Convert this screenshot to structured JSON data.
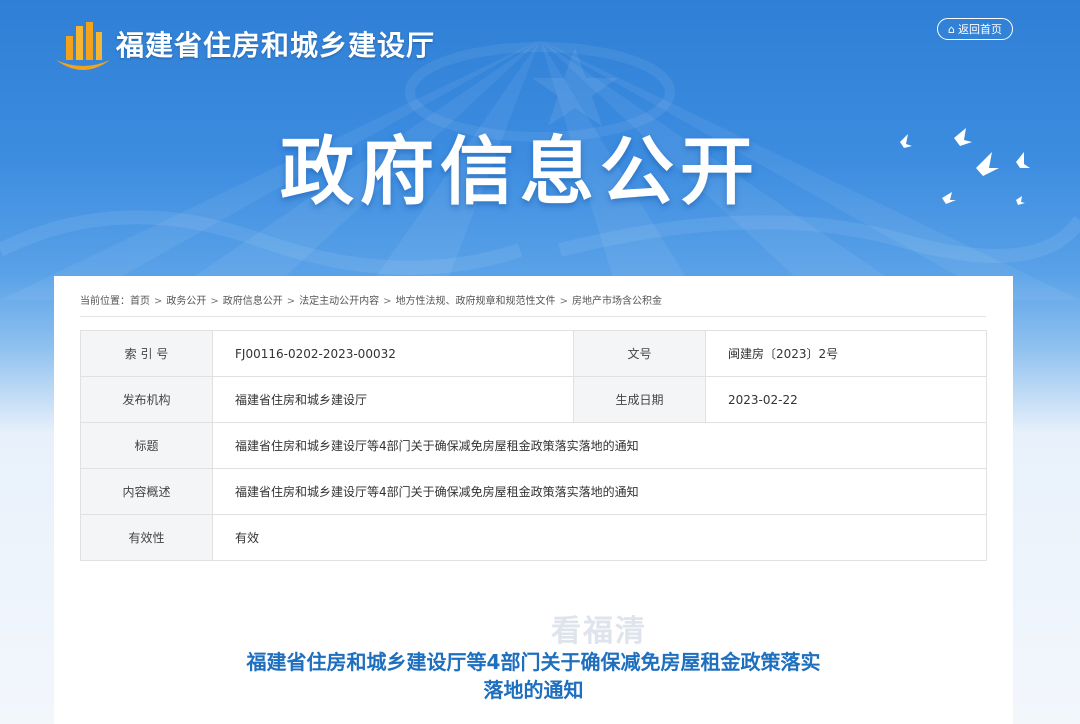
{
  "header": {
    "site_name": "福建省住房和城乡建设厅",
    "back_home_label": "返回首页",
    "hero_title": "政府信息公开"
  },
  "breadcrumb": {
    "prefix": "当前位置：",
    "items": [
      "首页",
      "政务公开",
      "政府信息公开",
      "法定主动公开内容",
      "地方性法规、政府规章和规范性文件",
      "房地产市场含公积金"
    ],
    "separator": ">"
  },
  "meta": {
    "index_no_label": "索 引 号",
    "index_no": "FJ00116-0202-2023-00032",
    "doc_no_label": "文号",
    "doc_no": "闽建房〔2023〕2号",
    "publisher_label": "发布机构",
    "publisher": "福建省住房和城乡建设厅",
    "date_label": "生成日期",
    "date": "2023-02-22",
    "title_label": "标题",
    "title": "福建省住房和城乡建设厅等4部门关于确保减免房屋租金政策落实落地的通知",
    "summary_label": "内容概述",
    "summary": "福建省住房和城乡建设厅等4部门关于确保减免房屋租金政策落实落地的通知",
    "validity_label": "有效性",
    "validity": "有效"
  },
  "article": {
    "title_line1": "福建省住房和城乡建设厅等4部门关于确保减免房屋租金政策落实",
    "title_line2": "落地的通知"
  },
  "watermark": "看福清",
  "colors": {
    "accent": "#1f6fbf",
    "banner_blue": "#2f7fd6"
  }
}
